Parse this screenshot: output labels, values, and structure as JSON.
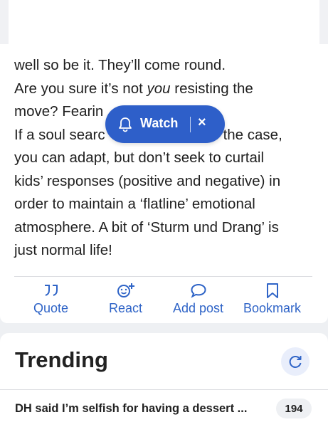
{
  "post": {
    "line1": "well so be it. They’ll come round.",
    "line2_pre": "Are you sure it’s not ",
    "line2_em": "you",
    "line2_post": " resisting the",
    "line3": "move? Fearin",
    "line4_pre": "If a soul searc",
    "line4_post": "s the case,",
    "line5": "you can adapt, but don’t seek to curtail",
    "line6": "kids’ responses (positive and negative) in",
    "line7": "order to maintain a ‘flatline’ emotional",
    "line8": "atmosphere. A bit of ‘Sturm und Drang’ is",
    "line9": "just normal life!"
  },
  "actions": {
    "quote": "Quote",
    "react": "React",
    "add_post": "Add post",
    "bookmark": "Bookmark"
  },
  "watch": {
    "label": "Watch",
    "close": "×"
  },
  "trending": {
    "title": "Trending",
    "items": [
      {
        "text": "DH said I’m selfish for having a dessert ...",
        "count": "194"
      }
    ]
  },
  "colors": {
    "accent": "#2e5fc9",
    "link": "#2f64c7"
  }
}
